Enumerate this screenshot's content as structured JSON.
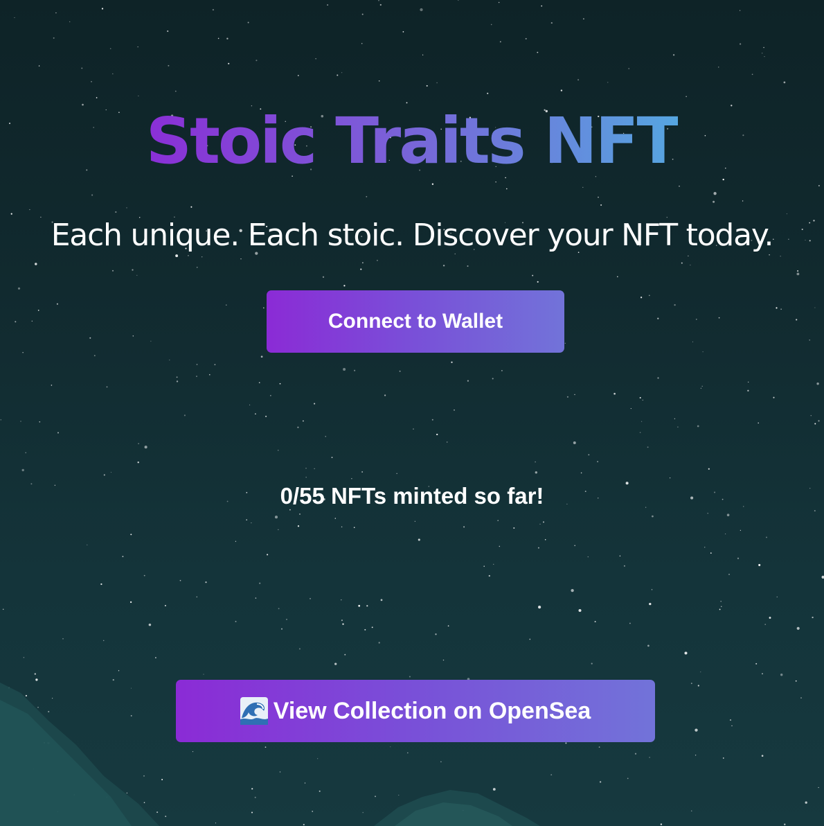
{
  "hero": {
    "title": "Stoic Traits NFT",
    "subtitle": "Each unique. Each stoic. Discover your NFT today."
  },
  "wallet": {
    "connect_label": "Connect to Wallet"
  },
  "mint": {
    "minted": 0,
    "total": 55,
    "status_text": "0/55 NFTs minted so far!"
  },
  "collection": {
    "opensea_label": "View Collection on OpenSea",
    "icon": "wave-icon"
  },
  "colors": {
    "background": "#112a2f",
    "accent_start": "#8b2bd6",
    "accent_end": "#7273d9",
    "title_gradient_end": "#56a6e0",
    "text": "#ffffff"
  }
}
